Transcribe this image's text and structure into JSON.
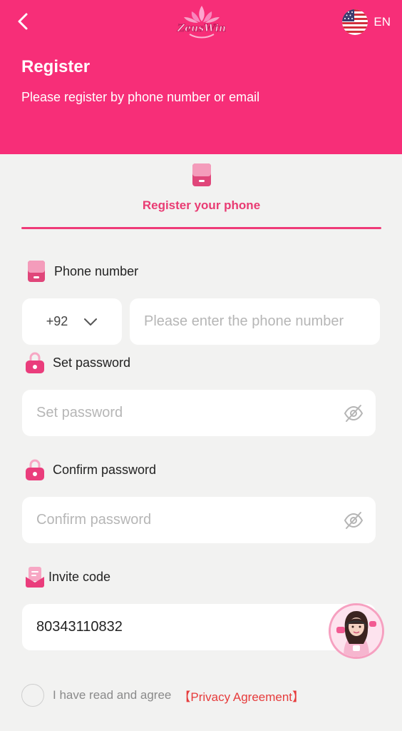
{
  "header": {
    "logo_text": "ZeusWin",
    "language": "EN",
    "title": "Register",
    "subtitle": "Please register by phone number or email"
  },
  "tab": {
    "label": "Register your phone"
  },
  "phone": {
    "label": "Phone number",
    "country_code": "+92",
    "placeholder": "Please enter the phone number"
  },
  "password": {
    "label": "Set password",
    "placeholder": "Set password"
  },
  "confirm_password": {
    "label": "Confirm password",
    "placeholder": "Confirm password"
  },
  "invite": {
    "label": "Invite code",
    "value": "80343110832"
  },
  "agreement": {
    "text": "I have read and agree",
    "link": "【Privacy Agreement】"
  },
  "colors": {
    "brand": "#f72e78",
    "accent": "#e93b73",
    "link": "#e63c3c"
  }
}
